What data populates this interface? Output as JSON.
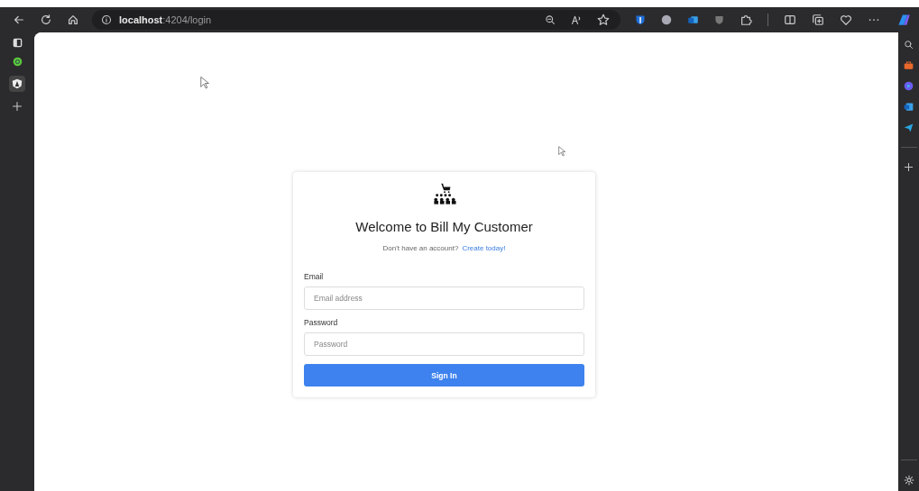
{
  "browser": {
    "address": "**localhost**:4204/login"
  },
  "login": {
    "title": "Welcome to Bill My Customer",
    "signup_prompt": "Don't have an account?",
    "signup_link": "Create today!",
    "fields": [
      {
        "label": "Email",
        "placeholder": "Email address"
      },
      {
        "label": "Password",
        "placeholder": "Password"
      }
    ],
    "submit": "Sign In"
  }
}
